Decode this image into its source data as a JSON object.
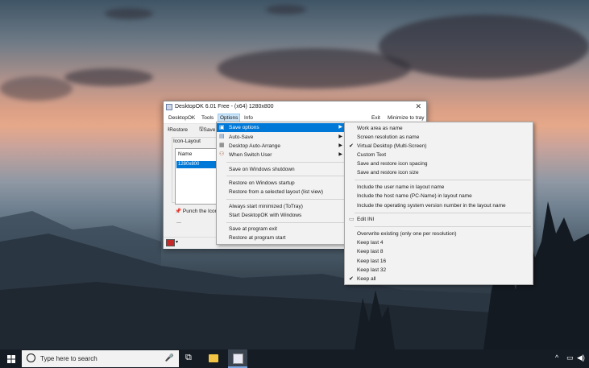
{
  "window": {
    "title": "DesktopOK 6.01 Free - (x64) 1280x800",
    "close_glyph": "✕",
    "menus": [
      "DesktopOK",
      "Tools",
      "Options",
      "Info"
    ],
    "right_actions": [
      "Exit",
      "Minimize to tray"
    ],
    "toolbar": {
      "restore": "Restore",
      "save": "Save"
    },
    "icon_layout_label": "Icon-Layout",
    "list_header": "Name",
    "list_rows": [
      "1280x800"
    ],
    "punch_label": "Punch the Icons",
    "ellipsis": "..."
  },
  "options_menu": [
    "Save options",
    "Auto-Save",
    "Desktop Auto-Arrange",
    "When Switch User",
    "Save on Windows shutdown",
    "Restore on Windows startup",
    "Restore from a selected layout (list view)",
    "Always start minimized (ToTray)",
    "Start DesktopOK with Windows",
    "Save at program exit",
    "Restore at program start"
  ],
  "save_options_submenu": [
    "Work area as name",
    "Screen resolution as name",
    "Virtual Desktop (Multi-Screen)",
    "Custom Text",
    "Save and restore icon spacing",
    "Save and restore icon size",
    "Include the user name in layout name",
    "Include the host name (PC-Name) in layout name",
    "Include the operating system version number in the layout name",
    "Edit INI",
    "Overwrite existing (only one per resolution)",
    "Keep last 4",
    "Keep last 8",
    "Keep last 16",
    "Keep last 32",
    "Keep all"
  ],
  "checked": [
    "Virtual Desktop (Multi-Screen)",
    "Keep all"
  ],
  "taskbar": {
    "search_placeholder": "Type here to search",
    "icons": [
      "windows-start-icon",
      "cortana-icon",
      "microphone-icon",
      "task-view-icon",
      "file-explorer-icon",
      "desktopok-icon"
    ]
  },
  "colors": {
    "accent": "#0078d7",
    "taskbar": "#151c24"
  }
}
